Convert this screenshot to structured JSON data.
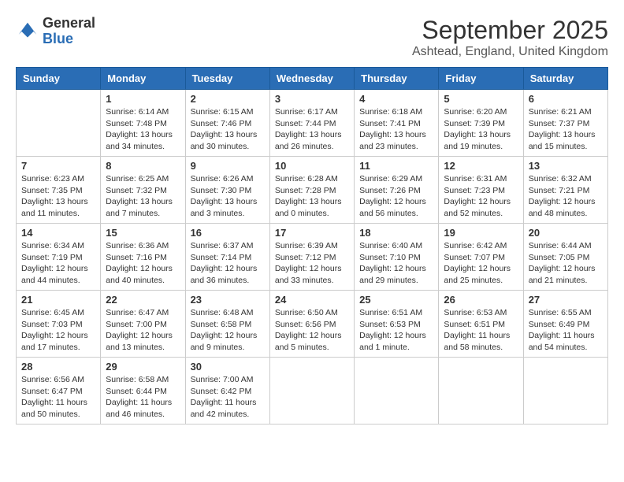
{
  "header": {
    "logo_general": "General",
    "logo_blue": "Blue",
    "month_title": "September 2025",
    "location": "Ashtead, England, United Kingdom"
  },
  "days_of_week": [
    "Sunday",
    "Monday",
    "Tuesday",
    "Wednesday",
    "Thursday",
    "Friday",
    "Saturday"
  ],
  "weeks": [
    [
      {
        "day": "",
        "sunrise": "",
        "sunset": "",
        "daylight": ""
      },
      {
        "day": "1",
        "sunrise": "Sunrise: 6:14 AM",
        "sunset": "Sunset: 7:48 PM",
        "daylight": "Daylight: 13 hours and 34 minutes."
      },
      {
        "day": "2",
        "sunrise": "Sunrise: 6:15 AM",
        "sunset": "Sunset: 7:46 PM",
        "daylight": "Daylight: 13 hours and 30 minutes."
      },
      {
        "day": "3",
        "sunrise": "Sunrise: 6:17 AM",
        "sunset": "Sunset: 7:44 PM",
        "daylight": "Daylight: 13 hours and 26 minutes."
      },
      {
        "day": "4",
        "sunrise": "Sunrise: 6:18 AM",
        "sunset": "Sunset: 7:41 PM",
        "daylight": "Daylight: 13 hours and 23 minutes."
      },
      {
        "day": "5",
        "sunrise": "Sunrise: 6:20 AM",
        "sunset": "Sunset: 7:39 PM",
        "daylight": "Daylight: 13 hours and 19 minutes."
      },
      {
        "day": "6",
        "sunrise": "Sunrise: 6:21 AM",
        "sunset": "Sunset: 7:37 PM",
        "daylight": "Daylight: 13 hours and 15 minutes."
      }
    ],
    [
      {
        "day": "7",
        "sunrise": "Sunrise: 6:23 AM",
        "sunset": "Sunset: 7:35 PM",
        "daylight": "Daylight: 13 hours and 11 minutes."
      },
      {
        "day": "8",
        "sunrise": "Sunrise: 6:25 AM",
        "sunset": "Sunset: 7:32 PM",
        "daylight": "Daylight: 13 hours and 7 minutes."
      },
      {
        "day": "9",
        "sunrise": "Sunrise: 6:26 AM",
        "sunset": "Sunset: 7:30 PM",
        "daylight": "Daylight: 13 hours and 3 minutes."
      },
      {
        "day": "10",
        "sunrise": "Sunrise: 6:28 AM",
        "sunset": "Sunset: 7:28 PM",
        "daylight": "Daylight: 13 hours and 0 minutes."
      },
      {
        "day": "11",
        "sunrise": "Sunrise: 6:29 AM",
        "sunset": "Sunset: 7:26 PM",
        "daylight": "Daylight: 12 hours and 56 minutes."
      },
      {
        "day": "12",
        "sunrise": "Sunrise: 6:31 AM",
        "sunset": "Sunset: 7:23 PM",
        "daylight": "Daylight: 12 hours and 52 minutes."
      },
      {
        "day": "13",
        "sunrise": "Sunrise: 6:32 AM",
        "sunset": "Sunset: 7:21 PM",
        "daylight": "Daylight: 12 hours and 48 minutes."
      }
    ],
    [
      {
        "day": "14",
        "sunrise": "Sunrise: 6:34 AM",
        "sunset": "Sunset: 7:19 PM",
        "daylight": "Daylight: 12 hours and 44 minutes."
      },
      {
        "day": "15",
        "sunrise": "Sunrise: 6:36 AM",
        "sunset": "Sunset: 7:16 PM",
        "daylight": "Daylight: 12 hours and 40 minutes."
      },
      {
        "day": "16",
        "sunrise": "Sunrise: 6:37 AM",
        "sunset": "Sunset: 7:14 PM",
        "daylight": "Daylight: 12 hours and 36 minutes."
      },
      {
        "day": "17",
        "sunrise": "Sunrise: 6:39 AM",
        "sunset": "Sunset: 7:12 PM",
        "daylight": "Daylight: 12 hours and 33 minutes."
      },
      {
        "day": "18",
        "sunrise": "Sunrise: 6:40 AM",
        "sunset": "Sunset: 7:10 PM",
        "daylight": "Daylight: 12 hours and 29 minutes."
      },
      {
        "day": "19",
        "sunrise": "Sunrise: 6:42 AM",
        "sunset": "Sunset: 7:07 PM",
        "daylight": "Daylight: 12 hours and 25 minutes."
      },
      {
        "day": "20",
        "sunrise": "Sunrise: 6:44 AM",
        "sunset": "Sunset: 7:05 PM",
        "daylight": "Daylight: 12 hours and 21 minutes."
      }
    ],
    [
      {
        "day": "21",
        "sunrise": "Sunrise: 6:45 AM",
        "sunset": "Sunset: 7:03 PM",
        "daylight": "Daylight: 12 hours and 17 minutes."
      },
      {
        "day": "22",
        "sunrise": "Sunrise: 6:47 AM",
        "sunset": "Sunset: 7:00 PM",
        "daylight": "Daylight: 12 hours and 13 minutes."
      },
      {
        "day": "23",
        "sunrise": "Sunrise: 6:48 AM",
        "sunset": "Sunset: 6:58 PM",
        "daylight": "Daylight: 12 hours and 9 minutes."
      },
      {
        "day": "24",
        "sunrise": "Sunrise: 6:50 AM",
        "sunset": "Sunset: 6:56 PM",
        "daylight": "Daylight: 12 hours and 5 minutes."
      },
      {
        "day": "25",
        "sunrise": "Sunrise: 6:51 AM",
        "sunset": "Sunset: 6:53 PM",
        "daylight": "Daylight: 12 hours and 1 minute."
      },
      {
        "day": "26",
        "sunrise": "Sunrise: 6:53 AM",
        "sunset": "Sunset: 6:51 PM",
        "daylight": "Daylight: 11 hours and 58 minutes."
      },
      {
        "day": "27",
        "sunrise": "Sunrise: 6:55 AM",
        "sunset": "Sunset: 6:49 PM",
        "daylight": "Daylight: 11 hours and 54 minutes."
      }
    ],
    [
      {
        "day": "28",
        "sunrise": "Sunrise: 6:56 AM",
        "sunset": "Sunset: 6:47 PM",
        "daylight": "Daylight: 11 hours and 50 minutes."
      },
      {
        "day": "29",
        "sunrise": "Sunrise: 6:58 AM",
        "sunset": "Sunset: 6:44 PM",
        "daylight": "Daylight: 11 hours and 46 minutes."
      },
      {
        "day": "30",
        "sunrise": "Sunrise: 7:00 AM",
        "sunset": "Sunset: 6:42 PM",
        "daylight": "Daylight: 11 hours and 42 minutes."
      },
      {
        "day": "",
        "sunrise": "",
        "sunset": "",
        "daylight": ""
      },
      {
        "day": "",
        "sunrise": "",
        "sunset": "",
        "daylight": ""
      },
      {
        "day": "",
        "sunrise": "",
        "sunset": "",
        "daylight": ""
      },
      {
        "day": "",
        "sunrise": "",
        "sunset": "",
        "daylight": ""
      }
    ]
  ]
}
